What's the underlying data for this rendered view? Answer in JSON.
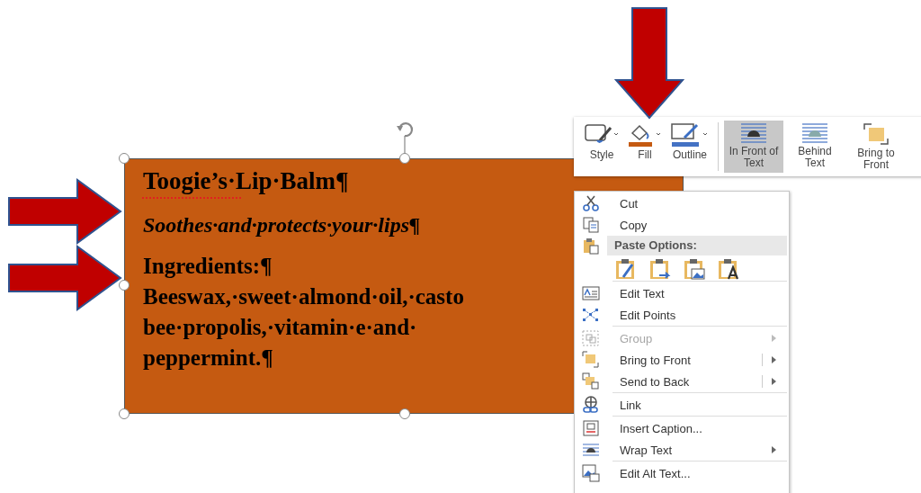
{
  "text_box": {
    "title": "Toogie’s·Lip·Balm¶",
    "subtitle": "Soothes·and·protects·your·lips¶",
    "lines": [
      "Ingredients:¶",
      "Beeswax,·sweet·almond·oil,·casto",
      "bee·propolis,·vitamin·e·and·",
      "peppermint.¶"
    ]
  },
  "toolbar": {
    "buttons": [
      {
        "kind": "style",
        "label": "Style",
        "selected": false
      },
      {
        "kind": "fill",
        "label": "Fill",
        "selected": false
      },
      {
        "kind": "outline",
        "label": "Outline",
        "selected": false
      },
      {
        "kind": "front",
        "label": "In Front of Text",
        "selected": true
      },
      {
        "kind": "behind",
        "label": "Behind Text",
        "selected": false
      },
      {
        "kind": "bring",
        "label": "Bring to Front",
        "selected": false
      }
    ]
  },
  "context_menu": {
    "items": [
      {
        "kind": "item",
        "label": "Cut",
        "disabled": false,
        "submenu": false,
        "split": false
      },
      {
        "kind": "item",
        "label": "Copy",
        "disabled": false,
        "submenu": false,
        "split": false
      },
      {
        "kind": "header",
        "label": "Paste Options:"
      },
      {
        "kind": "paste_row"
      },
      {
        "kind": "item",
        "label": "Edit Text",
        "disabled": false,
        "submenu": false,
        "split": false
      },
      {
        "kind": "item",
        "label": "Edit Points",
        "disabled": false,
        "submenu": false,
        "split": false
      },
      {
        "kind": "item",
        "label": "Group",
        "disabled": true,
        "submenu": true,
        "split": false
      },
      {
        "kind": "item",
        "label": "Bring to Front",
        "disabled": false,
        "submenu": true,
        "split": true
      },
      {
        "kind": "item",
        "label": "Send to Back",
        "disabled": false,
        "submenu": true,
        "split": true
      },
      {
        "kind": "item",
        "label": "Link",
        "disabled": false,
        "submenu": false,
        "split": false
      },
      {
        "kind": "item",
        "label": "Insert Caption...",
        "disabled": false,
        "submenu": false,
        "split": false
      },
      {
        "kind": "item",
        "label": "Wrap Text",
        "disabled": false,
        "submenu": true,
        "split": false
      },
      {
        "kind": "item",
        "label": "Edit Alt Text...",
        "disabled": false,
        "submenu": false,
        "split": false
      }
    ]
  }
}
